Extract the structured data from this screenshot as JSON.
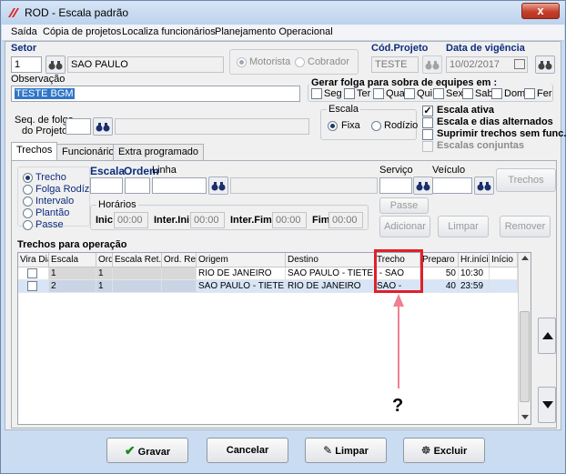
{
  "window": {
    "title": "ROD - Escala padrão",
    "close_glyph": "x"
  },
  "menu": [
    "Saída",
    "Cópia de projetos",
    "Localiza funcionários",
    "Planejamento Operacional"
  ],
  "header": {
    "setor_label": "Setor",
    "setor_code": "1",
    "setor_name": "SAO PAULO",
    "motorista_label": "Motorista",
    "cobrador_label": "Cobrador",
    "cod_projeto_label": "Cód.Projeto",
    "cod_projeto_value": "TESTE",
    "data_vigencia_label": "Data de vigência",
    "data_vigencia_value": "10/02/2017",
    "observacao_label": "Observação",
    "observacao_value": "TESTE BGM",
    "folga_label": "Gerar folga para sobra de equipes em :",
    "days": [
      "Seg",
      "Ter",
      "Qua",
      "Qui",
      "Sex",
      "Sab",
      "Dom",
      "Fer"
    ],
    "seq_folga_label_1": "Seq. de folga",
    "seq_folga_label_2": "do Projeto",
    "escala_group_label": "Escala",
    "fixa_label": "Fixa",
    "rodizio_label": "Rodízio",
    "escala_ativa_label": "Escala ativa",
    "escala_dias_alt_label": "Escala e dias alternados",
    "suprimir_label": "Suprimir trechos sem func.",
    "escalas_conjuntas_label": "Escalas conjuntas"
  },
  "tabs": [
    "Trechos",
    "Funcionários",
    "Extra programado"
  ],
  "trechos_panel": {
    "options": [
      "Trecho",
      "Folga Rodízio",
      "Intervalo",
      "Plantão",
      "Passe"
    ],
    "escala_label": "Escala",
    "ordem_label": "Ordem",
    "linha_label": "Linha",
    "servico_label": "Serviço",
    "veiculo_label": "Veículo",
    "trechos_button": "Trechos",
    "horarios_label": "Horários",
    "inic_label": "Inic",
    "inter_ini_label": "Inter.Ini",
    "inter_fim_label": "Inter.Fim",
    "fim_label": "Fim",
    "time_placeholder": "00:00",
    "passe_button": "Passe",
    "adicionar_button": "Adicionar",
    "limpar_button": "Limpar",
    "remover_button": "Remover",
    "grid_title": "Trechos para operação"
  },
  "grid": {
    "columns": [
      "Vira Dia",
      "Escala",
      "Ord",
      "Escala Ret.",
      "Ord. Ret.",
      "Origem",
      "Destino",
      "Trecho",
      "Preparo",
      "Hr.início",
      "Início"
    ],
    "rows": [
      {
        "escala": "1",
        "ord": "1",
        "origem": "RIO DE JANEIRO",
        "destino": "SAO PAULO - TIETE",
        "trecho": " - SAO",
        "preparo": "50",
        "hr_inicio": "10:30"
      },
      {
        "escala": "2",
        "ord": "1",
        "origem": "SAO PAULO - TIETE",
        "destino": "RIO DE JANEIRO",
        "trecho": "SAO -",
        "preparo": "40",
        "hr_inicio": "23:59"
      }
    ]
  },
  "annotation": {
    "question": "?",
    "highlight_color": "#e0202a"
  },
  "footer": {
    "gravar": "Gravar",
    "cancelar": "Cancelar",
    "limpar": "Limpar",
    "excluir": "Excluir"
  }
}
